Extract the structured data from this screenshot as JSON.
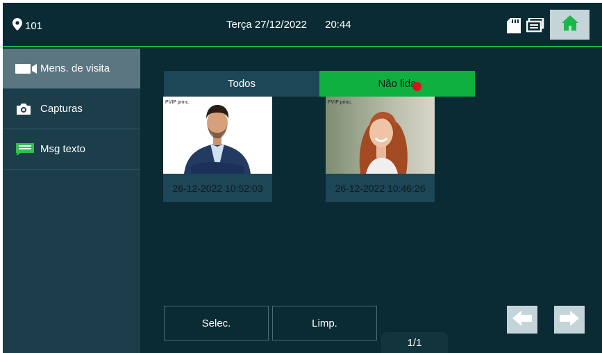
{
  "header": {
    "location_icon": "location-pin-icon",
    "room": "101",
    "day": "Terça",
    "date": "27/12/2022",
    "time": "20:44",
    "icons": [
      "sd-card-icon",
      "display-icon",
      "home-icon"
    ]
  },
  "sidebar": {
    "items": [
      {
        "label": "Mens. de visita",
        "icon": "video-camera-icon",
        "active": true
      },
      {
        "label": "Capturas",
        "icon": "camera-icon",
        "active": false
      },
      {
        "label": "Msg texto",
        "icon": "message-icon",
        "active": false
      }
    ]
  },
  "tabs": [
    {
      "label": "Todos",
      "active": false
    },
    {
      "label": "Não lida",
      "active": true,
      "unread_indicator": true
    }
  ],
  "messages": [
    {
      "source": "PVIP princ.",
      "timestamp": "26-12-2022 10:52:03"
    },
    {
      "source": "PVIP princ.",
      "timestamp": "26-12-2022 10:46:26"
    }
  ],
  "actions": {
    "select_label": "Selec.",
    "clear_label": "Limp."
  },
  "pagination": {
    "text": "1/1"
  },
  "colors": {
    "background": "#0a2b33",
    "sidebar": "#1c3e4b",
    "sidebar_active": "#5c7681",
    "accent_green": "#0fb040",
    "unread_dot": "#e0101a",
    "button_light": "#c4d4d8"
  }
}
